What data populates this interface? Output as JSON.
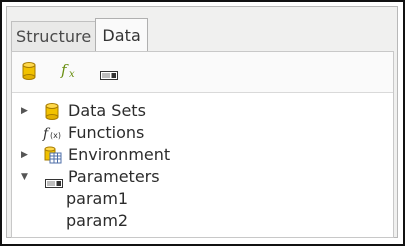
{
  "tabs": [
    {
      "label": "Structure",
      "active": false
    },
    {
      "label": "Data",
      "active": true
    }
  ],
  "toolbar": {
    "icons": [
      "database-icon",
      "function-icon",
      "parameter-icon"
    ]
  },
  "tree": {
    "data_sets": {
      "label": "Data Sets",
      "expanded": false
    },
    "functions": {
      "label": "Functions"
    },
    "environment": {
      "label": "Environment",
      "expanded": false
    },
    "parameters": {
      "label": "Parameters",
      "expanded": true,
      "children": [
        "param1",
        "param2"
      ]
    }
  },
  "colors": {
    "database": "#f2c200",
    "function": "#6a8f12",
    "accent": "#e0a800"
  }
}
